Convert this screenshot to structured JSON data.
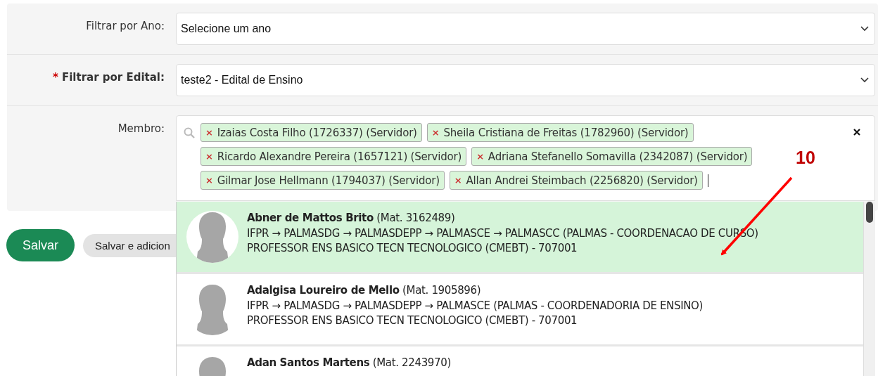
{
  "form": {
    "fields": [
      {
        "kind": "select",
        "label": "Filtrar por Ano:",
        "value": "Selecione um ano"
      },
      {
        "kind": "select",
        "required_mark": "*",
        "label": "Filtrar por Edital:",
        "value": "teste2 - Edital de Ensino"
      },
      {
        "kind": "multi",
        "label": "Membro:",
        "chips": [
          {
            "remove": "×",
            "text": "Izaias Costa Filho (1726337) (Servidor)"
          },
          {
            "remove": "×",
            "text": "Sheila Cristiana de Freitas (1782960) (Servidor)"
          },
          {
            "remove": "×",
            "text": "Ricardo Alexandre Pereira (1657121) (Servidor)"
          },
          {
            "remove": "×",
            "text": "Adriana Stefanello Somavilla (2342087) (Servidor)"
          },
          {
            "remove": "×",
            "text": "Gilmar Jose Hellmann (1794037) (Servidor)"
          },
          {
            "remove": "×",
            "text": "Allan Andrei Steimbach (2256820) (Servidor)"
          }
        ]
      }
    ]
  },
  "buttons": [
    {
      "kind": "primary",
      "label": "Salvar"
    },
    {
      "kind": "secondary",
      "label": "Salvar e adicion"
    }
  ],
  "dropdown": {
    "options": [
      {
        "title": "**Abner de Mattos Brito** (Mat. 3162489)",
        "path": "IFPR → PALMASDG → PALMASDEPP → PALMASCE → PALMASCC (PALMAS - COORDENACAO DE CURSO)",
        "role": "PROFESSOR ENS BASICO TECN TECNOLOGICO (CMEBT) - 707001",
        "selected": true
      },
      {
        "title": "**Adalgisa Loureiro de Mello** (Mat. 1905896)",
        "path": "IFPR → PALMASDG → PALMASDEPP → PALMASCE (PALMAS - COORDENADORIA DE ENSINO)",
        "role": "PROFESSOR ENS BASICO TECN TECNOLOGICO (CMEBT) - 707001",
        "selected": false
      },
      {
        "title": "**Adan Santos Martens** (Mat. 2243970)",
        "selected": false
      }
    ]
  },
  "annotation": {
    "label": "10"
  }
}
